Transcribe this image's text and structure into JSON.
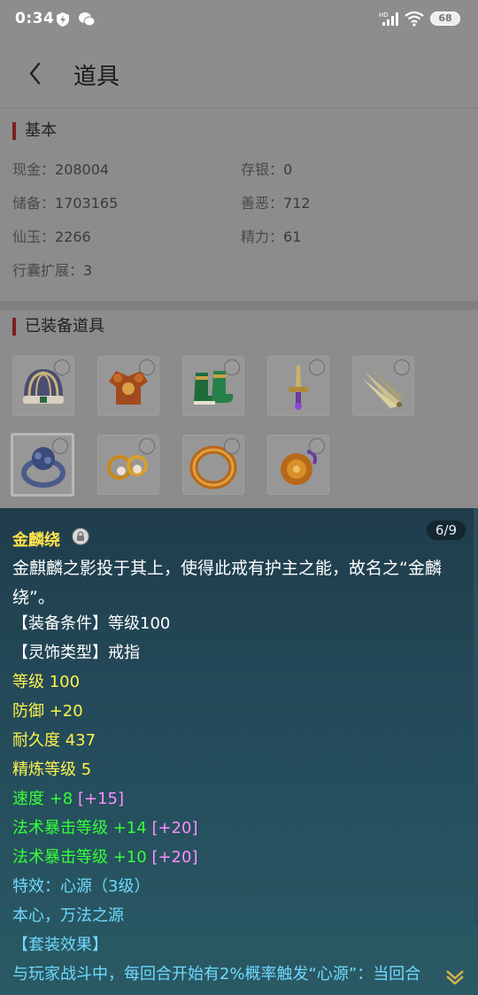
{
  "status_bar": {
    "time": "0:34",
    "battery": "68"
  },
  "header": {
    "title": "道具"
  },
  "basic": {
    "heading": "基本",
    "fields": [
      {
        "label": "现金：",
        "value": "208004"
      },
      {
        "label": "存银：",
        "value": "0"
      },
      {
        "label": "储备：",
        "value": "1703165"
      },
      {
        "label": "善恶：",
        "value": "712"
      },
      {
        "label": "仙玉：",
        "value": "2266"
      },
      {
        "label": "精力：",
        "value": "61"
      },
      {
        "label": "行囊扩展：",
        "value": "3"
      }
    ]
  },
  "equipped": {
    "heading": "已装备道具",
    "items": [
      {
        "icon": "helmet-icon"
      },
      {
        "icon": "armor-icon"
      },
      {
        "icon": "boots-icon"
      },
      {
        "icon": "sword-icon"
      },
      {
        "icon": "fan-icon"
      },
      {
        "icon": "ring-icon"
      },
      {
        "icon": "earring-icon"
      },
      {
        "icon": "bracelet-icon"
      },
      {
        "icon": "pendant-icon"
      }
    ]
  },
  "tooltip": {
    "name": "金麟绕",
    "counter": "6/9",
    "description": "金麒麟之影投于其上，使得此戒有护主之能，故名之“金麟绕”。",
    "requirement": "【装备条件】等级100",
    "type": "【灵饰类型】戒指",
    "level": "等级 100",
    "defense": "防御 +20",
    "durability": "耐久度 437",
    "refine": "精炼等级 5",
    "speed": "速度 +8",
    "speed_bonus": "[+15]",
    "crit1": "法术暴击等级 +14",
    "crit1_bonus": "[+20]",
    "crit2": "法术暴击等级 +10",
    "crit2_bonus": "[+20]",
    "effect": "特效：心源（3级）",
    "effect_desc": "本心，万法之源",
    "set_heading": "【套装效果】",
    "set_desc": "与玩家战斗中，每回合开始有2%概率触发“心源”：当回合"
  },
  "colors": {
    "name": "#ffe34a",
    "yellow_stat": "#fff34d",
    "green_stat": "#36ff3a",
    "bonus": "#ff8dff",
    "effect": "#6fd9ff"
  }
}
